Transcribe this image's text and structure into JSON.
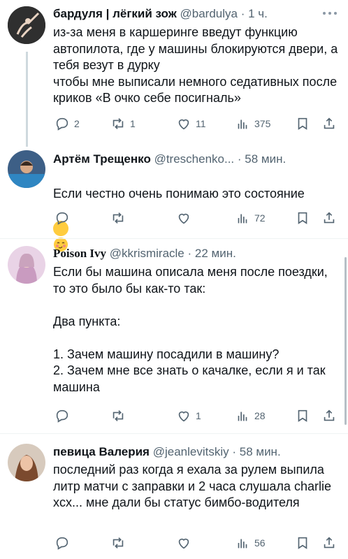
{
  "tweets": [
    {
      "name": "бардуля | лёгкий зож",
      "handle": "@bardulya",
      "time": "· 1 ч.",
      "text": "из-за меня в каршеринге введут функцию автопилота, где у машины блокируются двери, а тебя везут в дурку\nчтобы мне выписали немного седативных после криков «В очко себе посигналь»",
      "replies": "2",
      "retweets": "1",
      "likes": "11",
      "views": "375"
    },
    {
      "name": "Артём Трещенко",
      "handle": "@treschenko...",
      "time": "· 58 мин.",
      "text": "Если честно очень понимаю это состояние",
      "emoji": "blushing-face-icon",
      "replies": "",
      "retweets": "",
      "likes": "",
      "views": "72"
    },
    {
      "name": "Poison Ivy",
      "handle": "@kkrismiracle",
      "time": "· 22 мин.",
      "text": "Если бы машина описала меня после поездки, то это было бы как-то так:\n\nДва пункта:\n\n1. Зачем машину посадили в машину?\n2. Зачем мне все знать о качалке, если я и так машина",
      "replies": "",
      "retweets": "",
      "likes": "1",
      "views": "28"
    },
    {
      "name": "певица Валерия",
      "handle": "@jeanlevitskiy",
      "time": "· 58 мин.",
      "text": "последний раз когда я ехала за рулем выпила литр матчи с заправки и 2 часа слушала charlie xcx... мне дали бы статус бимбо-водителя",
      "replies": "",
      "retweets": "",
      "likes": "",
      "views": "56"
    }
  ],
  "colors": {
    "text": "#0f1419",
    "secondary": "#536471",
    "divider": "#eff3f4",
    "thread_line": "#cfd9de"
  }
}
